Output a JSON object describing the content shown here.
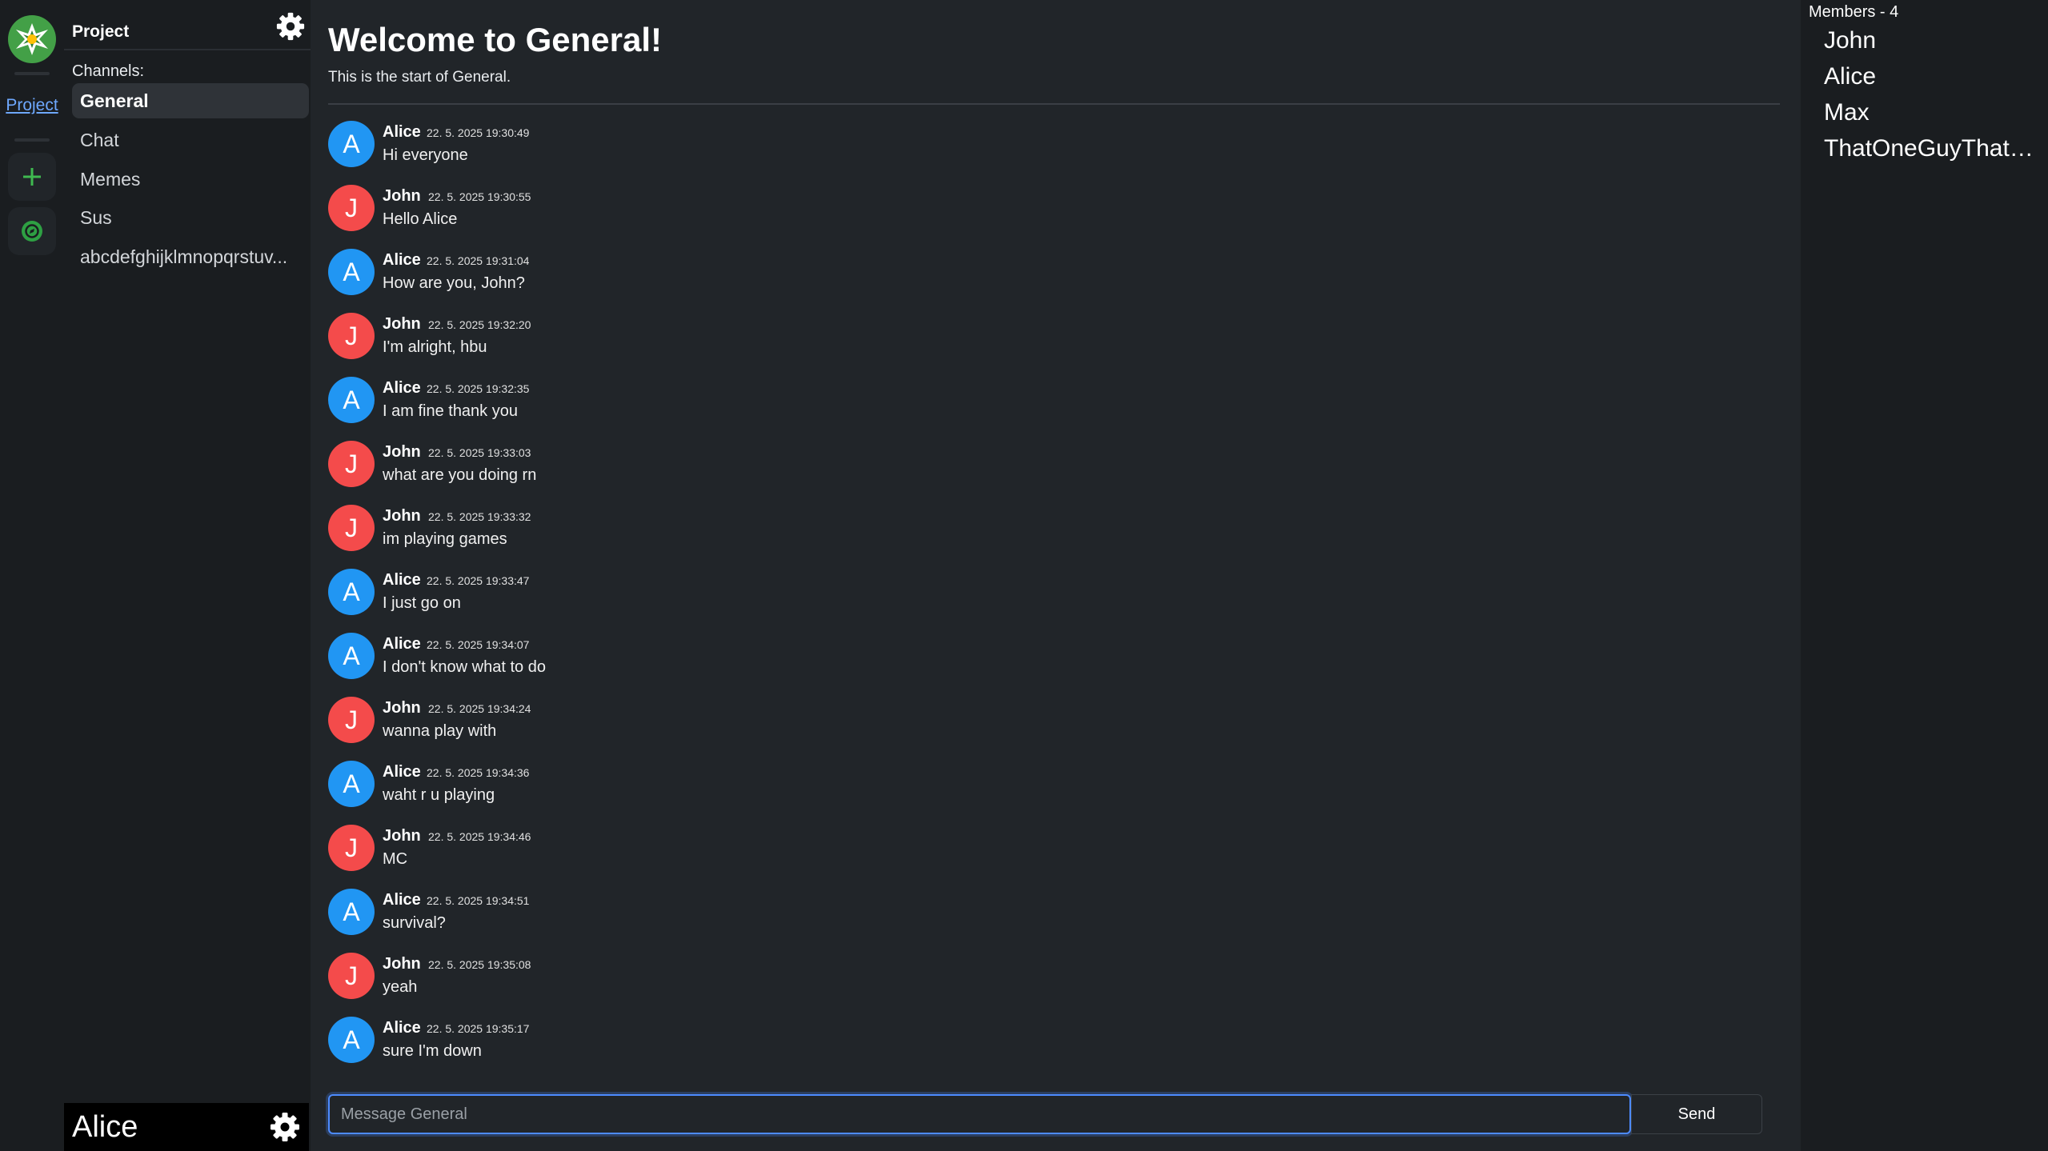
{
  "rail": {
    "project_link": "Project",
    "icons": [
      "server-logo-icon",
      "plus-icon",
      "compass-icon"
    ]
  },
  "sidebar": {
    "project_title": "Project",
    "channels_label": "Channels:",
    "channels": [
      {
        "label": "General",
        "active": true
      },
      {
        "label": "Chat",
        "active": false
      },
      {
        "label": "Memes",
        "active": false
      },
      {
        "label": "Sus",
        "active": false
      },
      {
        "label": "abcdefghijklmnopqrstuv...",
        "active": false
      }
    ],
    "user_name": "Alice"
  },
  "main": {
    "welcome_title": "Welcome to General!",
    "welcome_sub": "This is the start of General.",
    "messages": [
      {
        "initial": "A",
        "author": "Alice",
        "time": "22. 5. 2025 19:30:49",
        "text": "Hi everyone",
        "color": "#2196f3"
      },
      {
        "initial": "J",
        "author": "John",
        "time": "22. 5. 2025 19:30:55",
        "text": "Hello Alice",
        "color": "#f44b4b"
      },
      {
        "initial": "A",
        "author": "Alice",
        "time": "22. 5. 2025 19:31:04",
        "text": "How are you, John?",
        "color": "#2196f3"
      },
      {
        "initial": "J",
        "author": "John",
        "time": "22. 5. 2025 19:32:20",
        "text": "I'm alright, hbu",
        "color": "#f44b4b"
      },
      {
        "initial": "A",
        "author": "Alice",
        "time": "22. 5. 2025 19:32:35",
        "text": "I am fine thank you",
        "color": "#2196f3"
      },
      {
        "initial": "J",
        "author": "John",
        "time": "22. 5. 2025 19:33:03",
        "text": "what are you doing rn",
        "color": "#f44b4b"
      },
      {
        "initial": "J",
        "author": "John",
        "time": "22. 5. 2025 19:33:32",
        "text": "im playing games",
        "color": "#f44b4b"
      },
      {
        "initial": "A",
        "author": "Alice",
        "time": "22. 5. 2025 19:33:47",
        "text": "I just go on",
        "color": "#2196f3"
      },
      {
        "initial": "A",
        "author": "Alice",
        "time": "22. 5. 2025 19:34:07",
        "text": "I don't know what to do",
        "color": "#2196f3"
      },
      {
        "initial": "J",
        "author": "John",
        "time": "22. 5. 2025 19:34:24",
        "text": "wanna play with",
        "color": "#f44b4b"
      },
      {
        "initial": "A",
        "author": "Alice",
        "time": "22. 5. 2025 19:34:36",
        "text": "waht r u playing",
        "color": "#2196f3"
      },
      {
        "initial": "J",
        "author": "John",
        "time": "22. 5. 2025 19:34:46",
        "text": "MC",
        "color": "#f44b4b"
      },
      {
        "initial": "A",
        "author": "Alice",
        "time": "22. 5. 2025 19:34:51",
        "text": "survival?",
        "color": "#2196f3"
      },
      {
        "initial": "J",
        "author": "John",
        "time": "22. 5. 2025 19:35:08",
        "text": "yeah",
        "color": "#f44b4b"
      },
      {
        "initial": "A",
        "author": "Alice",
        "time": "22. 5. 2025 19:35:17",
        "text": "sure I'm down",
        "color": "#2196f3"
      }
    ],
    "composer": {
      "placeholder": "Message General",
      "value": "",
      "send_label": "Send"
    }
  },
  "members": {
    "header": "Members - 4",
    "list": [
      "John",
      "Alice",
      "Max",
      "ThatOneGuyThatH..."
    ]
  },
  "colors": {
    "accent": "#4d8bff",
    "alice": "#2196f3",
    "john": "#f44b4b",
    "server": "#43a047",
    "link": "#6ea8fe"
  }
}
